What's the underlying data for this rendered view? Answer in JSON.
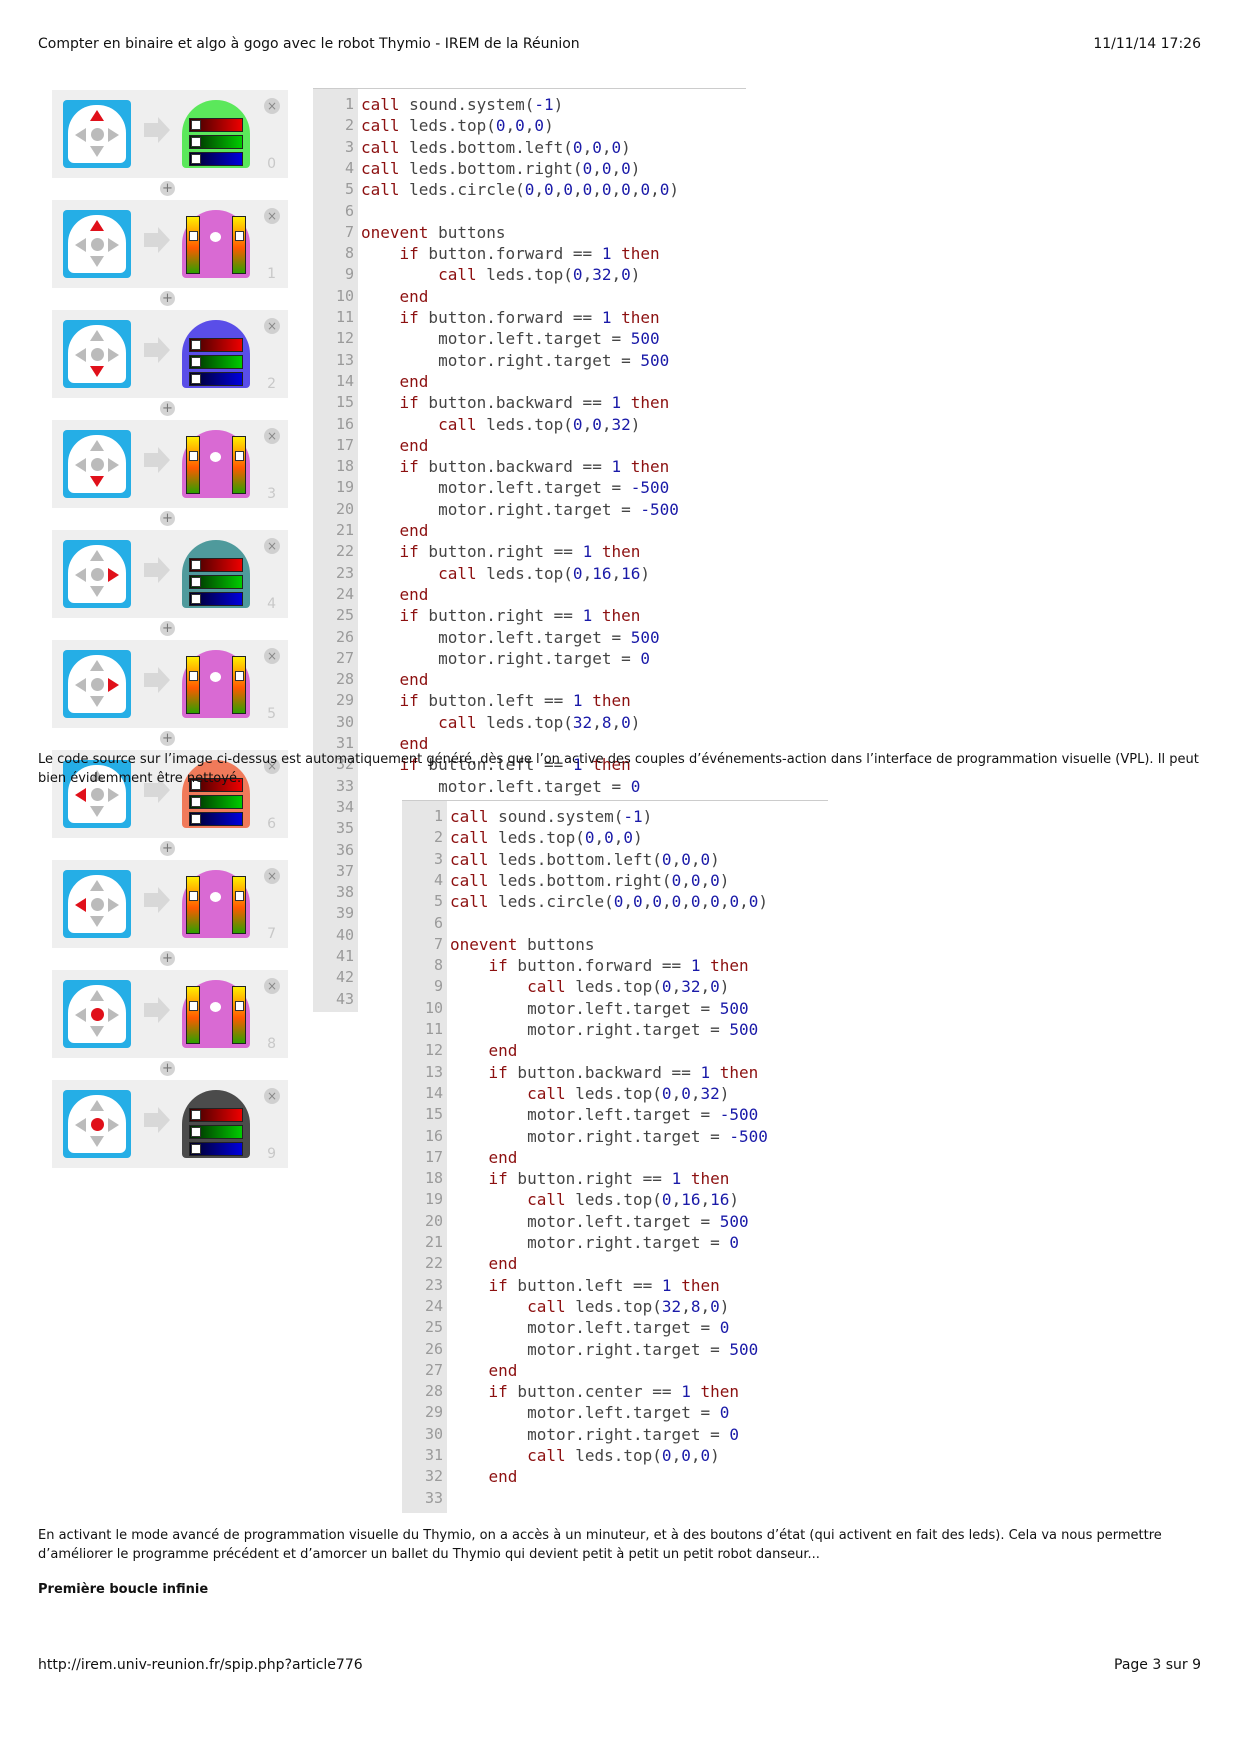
{
  "header": {
    "title": "Compter en binaire et algo à gogo avec le robot Thymio - IREM de la Réunion",
    "datetime": "11/11/14 17:26"
  },
  "footer": {
    "url": "http://irem.univ-reunion.fr/spip.php?article776",
    "page": "Page 3 sur 9"
  },
  "vpl": {
    "close_symbol": "×",
    "plus_symbol": "+",
    "pairs": [
      {
        "index": "0",
        "event": "forward",
        "action": "top-color",
        "color": "#5be85b"
      },
      {
        "index": "1",
        "event": "forward",
        "action": "motors",
        "color": "#d96ad3"
      },
      {
        "index": "2",
        "event": "backward",
        "action": "top-color",
        "color": "#5a4ee8"
      },
      {
        "index": "3",
        "event": "backward",
        "action": "motors",
        "color": "#d96ad3"
      },
      {
        "index": "4",
        "event": "right",
        "action": "top-color",
        "color": "#4f9a9c"
      },
      {
        "index": "5",
        "event": "right",
        "action": "motors",
        "color": "#d96ad3"
      },
      {
        "index": "6",
        "event": "left",
        "action": "top-color",
        "color": "#f07a5a"
      },
      {
        "index": "7",
        "event": "left",
        "action": "motors",
        "color": "#d96ad3"
      },
      {
        "index": "8",
        "event": "center",
        "action": "motors",
        "color": "#d96ad3"
      },
      {
        "index": "9",
        "event": "center",
        "action": "top-color",
        "color": "#4b4b4b"
      }
    ]
  },
  "code1": {
    "line_numbers": [
      "1",
      "2",
      "3",
      "4",
      "5",
      "6",
      "7",
      "8",
      "9",
      "10",
      "11",
      "12",
      "13",
      "14",
      "15",
      "16",
      "17",
      "18",
      "19",
      "20",
      "21",
      "22",
      "23",
      "24",
      "25",
      "26",
      "27",
      "28",
      "29",
      "30",
      "31",
      "32",
      "33",
      "34",
      "35",
      "36",
      "37",
      "38",
      "39",
      "40",
      "41",
      "42",
      "43"
    ],
    "visible_lines": [
      "call sound.system(-1)",
      "call leds.top(0,0,0)",
      "call leds.bottom.left(0,0,0)",
      "call leds.bottom.right(0,0,0)",
      "call leds.circle(0,0,0,0,0,0,0,0)",
      "",
      "onevent buttons",
      "    if button.forward == 1 then",
      "        call leds.top(0,32,0)",
      "    end",
      "    if button.forward == 1 then",
      "        motor.left.target = 500",
      "        motor.right.target = 500",
      "    end",
      "    if button.backward == 1 then",
      "        call leds.top(0,0,32)",
      "    end",
      "    if button.backward == 1 then",
      "        motor.left.target = -500",
      "        motor.right.target = -500",
      "    end",
      "    if button.right == 1 then",
      "        call leds.top(0,16,16)",
      "    end",
      "    if button.right == 1 then",
      "        motor.left.target = 500",
      "        motor.right.target = 0",
      "    end",
      "    if button.left == 1 then",
      "        call leds.top(32,8,0)",
      "    end",
      "    if button.left == 1 then",
      "        motor.left.target = 0"
    ]
  },
  "code2": {
    "lines": [
      "call sound.system(-1)",
      "call leds.top(0,0,0)",
      "call leds.bottom.left(0,0,0)",
      "call leds.bottom.right(0,0,0)",
      "call leds.circle(0,0,0,0,0,0,0,0)",
      "",
      "onevent buttons",
      "    if button.forward == 1 then",
      "        call leds.top(0,32,0)",
      "        motor.left.target = 500",
      "        motor.right.target = 500",
      "    end",
      "    if button.backward == 1 then",
      "        call leds.top(0,0,32)",
      "        motor.left.target = -500",
      "        motor.right.target = -500",
      "    end",
      "    if button.right == 1 then",
      "        call leds.top(0,16,16)",
      "        motor.left.target = 500",
      "        motor.right.target = 0",
      "    end",
      "    if button.left == 1 then",
      "        call leds.top(32,8,0)",
      "        motor.left.target = 0",
      "        motor.right.target = 500",
      "    end",
      "    if button.center == 1 then",
      "        motor.left.target = 0",
      "        motor.right.target = 0",
      "        call leds.top(0,0,0)",
      "    end",
      ""
    ]
  },
  "text": {
    "caption": "Le code source sur l’image ci-dessus est automatiquement généré, dès que l’on active des couples d’événements-action dans l’interface de programmation visuelle (VPL). Il peut bien évidemment être nettoyé.",
    "paragraph": "En activant le mode avancé de programmation visuelle du Thymio, on a accès à un minuteur, et à des boutons d’état (qui activent en fait des leds). Cela va nous permettre d’améliorer le programme précédent et d’amorcer un ballet du Thymio qui devient petit à petit un petit robot danseur...",
    "heading": "Première boucle infinie"
  }
}
